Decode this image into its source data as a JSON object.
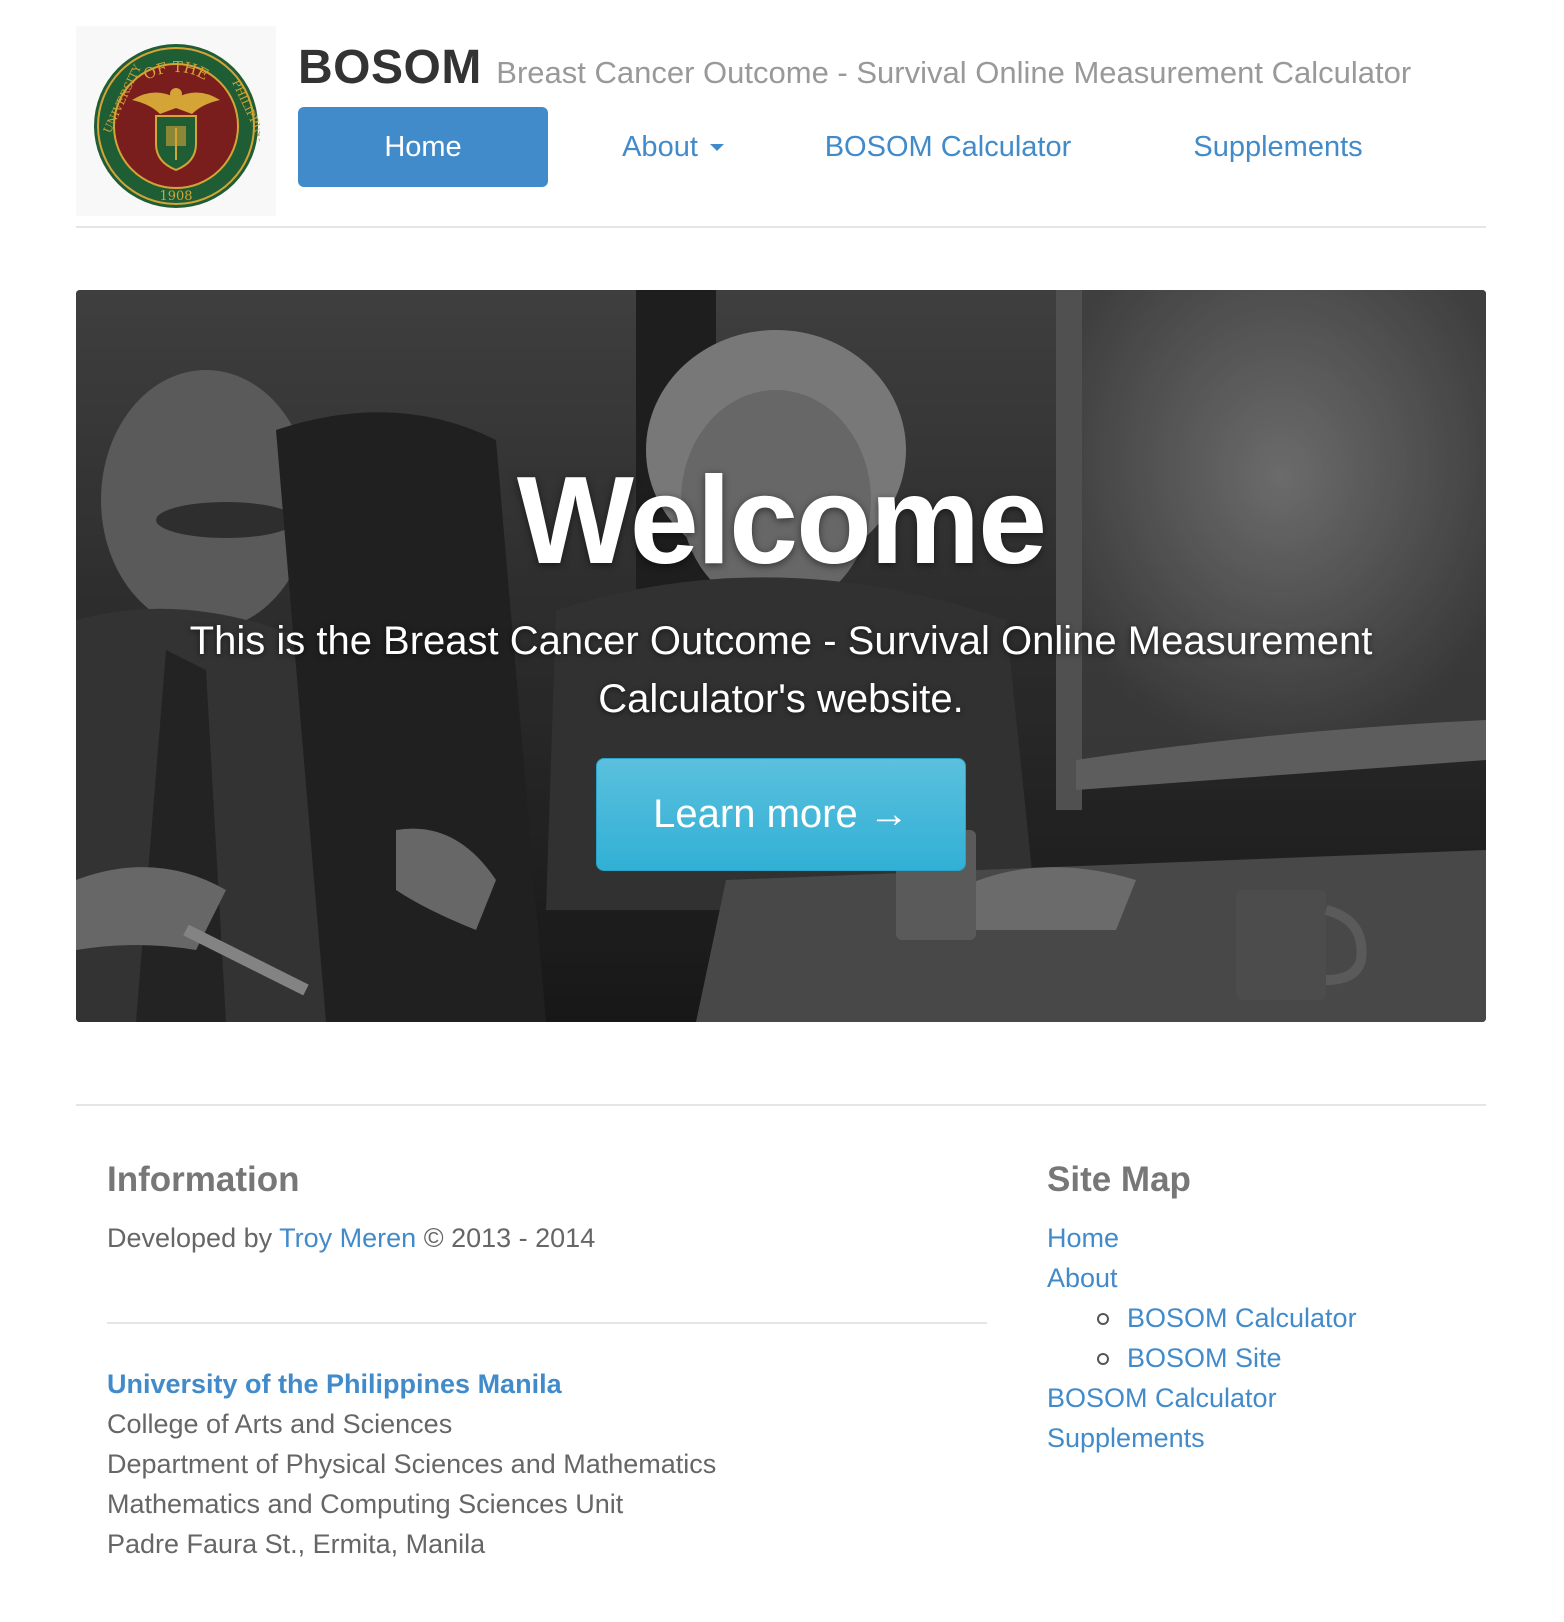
{
  "header": {
    "brand_title": "BOSOM",
    "brand_subtitle": "Breast Cancer Outcome - Survival Online Measurement Calculator",
    "logo": {
      "top_text": "OF THE",
      "left_text": "UNIVERSITY",
      "right_text": "PHILIPPINES",
      "year": "1908"
    }
  },
  "nav": {
    "home": "Home",
    "about": "About",
    "calculator": "BOSOM Calculator",
    "supplements": "Supplements"
  },
  "hero": {
    "title": "Welcome",
    "lead": "This is the Breast Cancer Outcome - Survival Online Measurement Calculator's website.",
    "button": "Learn more →"
  },
  "footer": {
    "info_heading": "Information",
    "developed_prefix": "Developed by",
    "developer": "Troy Meren",
    "copyright": "© 2013 - 2014",
    "university": "University of the Philippines Manila",
    "address_lines": [
      "College of Arts and Sciences",
      "Department of Physical Sciences and Mathematics",
      "Mathematics and Computing Sciences Unit",
      "Padre Faura St., Ermita, Manila"
    ],
    "sitemap_heading": "Site Map",
    "sitemap": {
      "home": "Home",
      "about": "About",
      "about_children": [
        "BOSOM Calculator",
        "BOSOM Site"
      ],
      "calculator": "BOSOM Calculator",
      "supplements": "Supplements"
    }
  },
  "colors": {
    "primary": "#428bca",
    "info_button": "#5bc0de",
    "muted_text": "#999999",
    "seal_maroon": "#7a1d1d",
    "seal_green": "#1f5e35",
    "seal_gold": "#d4a437"
  }
}
